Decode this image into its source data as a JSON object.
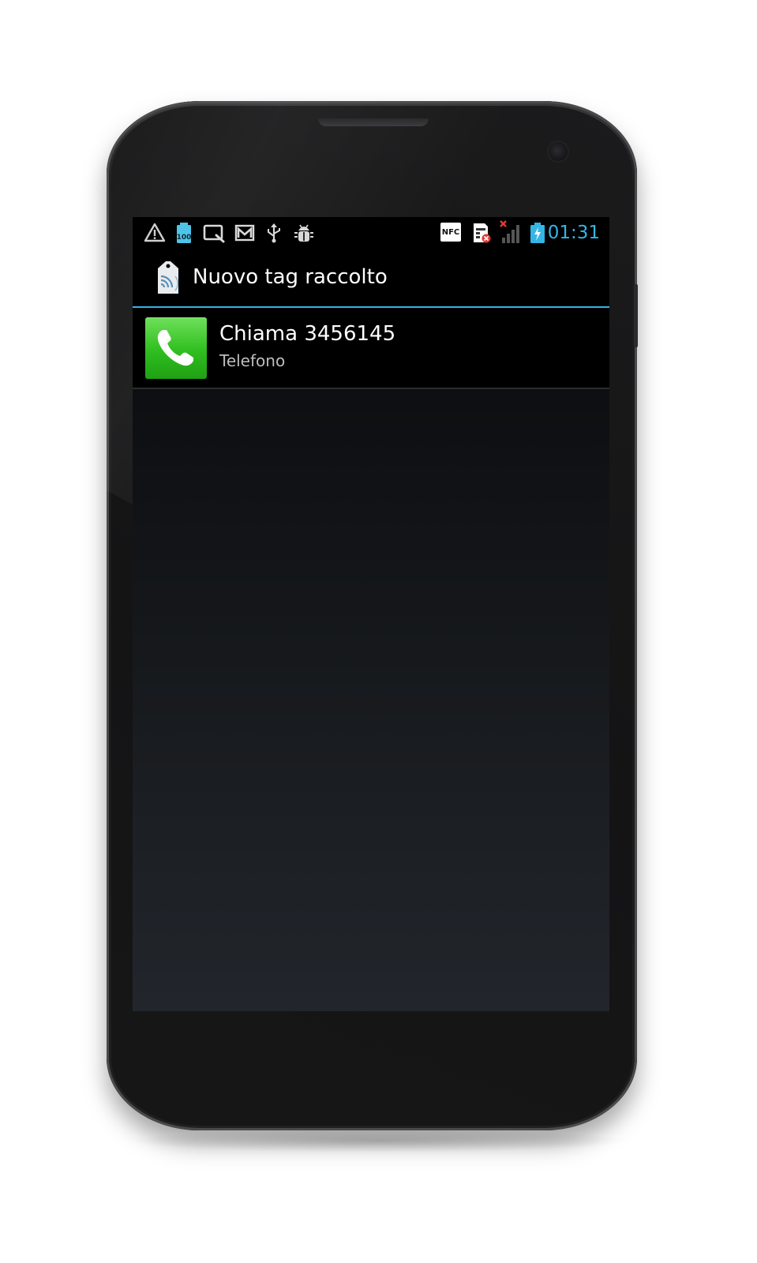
{
  "status_bar": {
    "left_icons": [
      "warning-icon",
      "battery-100-icon",
      "quick-search-icon",
      "gmail-icon",
      "usb-icon",
      "android-debug-icon"
    ],
    "right_icons": [
      "nfc-icon",
      "sim-missing-icon",
      "signal-no-service-icon",
      "battery-charging-icon"
    ],
    "nfc_label": "NFC",
    "battery_label": "100",
    "time": "01:31",
    "accent_color": "#33b5e5"
  },
  "dialog": {
    "title": "Nuovo tag raccolto",
    "title_icon": "nfc-tag-icon"
  },
  "actions": [
    {
      "title": "Chiama 3456145",
      "subtitle": "Telefono",
      "icon": "phone-icon",
      "icon_color": "#2fbe1f"
    }
  ]
}
